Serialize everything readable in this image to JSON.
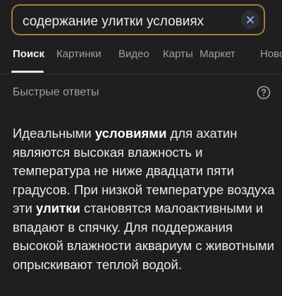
{
  "search": {
    "query": "содержание улитки условиях"
  },
  "tabs": [
    {
      "label": "Поиск"
    },
    {
      "label": "Картинки"
    },
    {
      "label": "Видео"
    },
    {
      "label": "Карты"
    },
    {
      "label": "Маркет"
    },
    {
      "label": "Новости"
    }
  ],
  "section": {
    "title": "Быстрые ответы"
  },
  "answer": {
    "p1": "Идеальными ",
    "b1": "условиями",
    "p2": " для ахатин являются высокая влажность и температура не ниже двадцати пяти градусов. При низкой температуре воздуха эти ",
    "b2": "улитки",
    "p3": " становятся малоактивными и впадают в спячку. Для поддержания высокой влажности аквариум с животными опрыскивают теплой водой."
  },
  "icons": {
    "clear": "close-icon",
    "help": "question-circle-icon"
  },
  "colors": {
    "background": "#1f1f1f",
    "search_border": "#a67c34",
    "text_primary": "#e8eaed",
    "text_secondary": "#9aa0a6"
  }
}
